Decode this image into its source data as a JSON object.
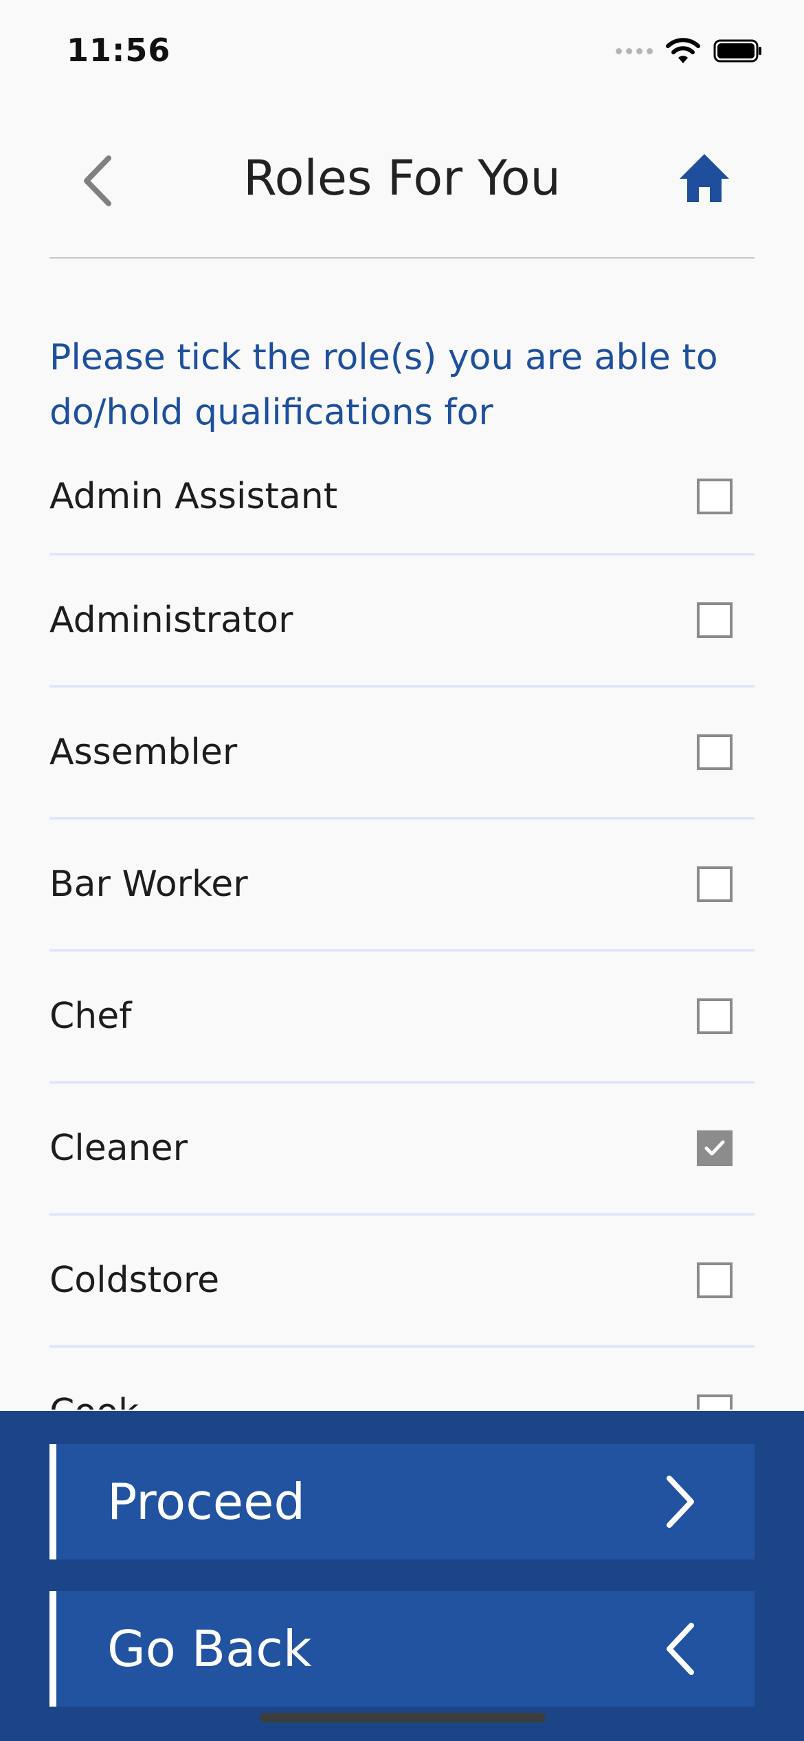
{
  "status_bar": {
    "time": "11:56"
  },
  "header": {
    "title": "Roles For You"
  },
  "instruction": "Please tick the role(s) you are able to do/hold qualifications for",
  "roles": [
    {
      "label": "Admin Assistant",
      "checked": false
    },
    {
      "label": "Administrator",
      "checked": false
    },
    {
      "label": "Assembler",
      "checked": false
    },
    {
      "label": "Bar Worker",
      "checked": false
    },
    {
      "label": "Chef",
      "checked": false
    },
    {
      "label": "Cleaner",
      "checked": true
    },
    {
      "label": "Coldstore",
      "checked": false
    },
    {
      "label": "Cook",
      "checked": false
    }
  ],
  "actions": {
    "proceed_label": "Proceed",
    "back_label": "Go Back"
  },
  "colors": {
    "accent": "#1e4f9c",
    "panel": "#1b4587",
    "button": "#2253a1",
    "divider": "#e1e6fb",
    "checked": "#8c8c8c"
  },
  "icons": {
    "back": "chevron-left-icon",
    "home": "home-icon",
    "proceed": "chevron-right-icon",
    "go_back": "chevron-left-icon"
  }
}
